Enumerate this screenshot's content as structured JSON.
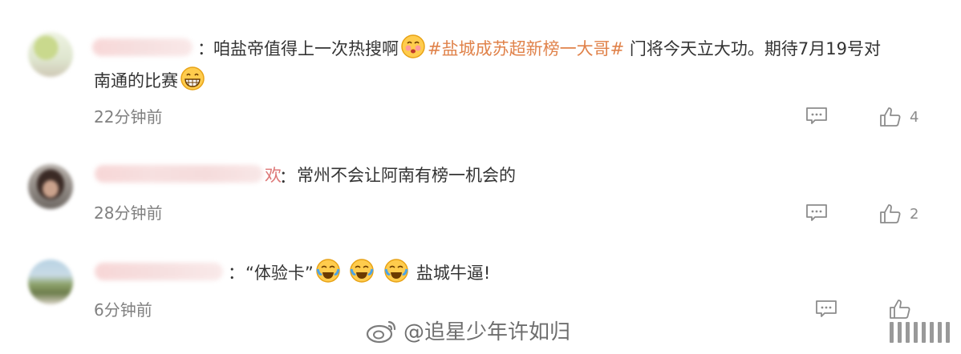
{
  "comments": [
    {
      "text_prefix": "咱盐帝值得上一次热搜啊",
      "topic": "#盐城成苏超新榜一大哥#",
      "text_suffix_1": "门将今天立大功。期待7月19号对",
      "text_line2": "南通的比赛",
      "time": "22分钟前",
      "likes": "4"
    },
    {
      "text": "常州不会让阿南有榜一机会的",
      "time": "28分钟前",
      "likes": "2"
    },
    {
      "quote": "“体验卡”",
      "text_after": "盐城牛逼!",
      "time": "6分钟前"
    }
  ],
  "colon": "：",
  "name_fragment_2": "欢",
  "watermark": {
    "text": "@追星少年许如归",
    "icon": "weibo-logo-icon"
  },
  "colors": {
    "topic": "#e0824a",
    "time": "#808080"
  }
}
